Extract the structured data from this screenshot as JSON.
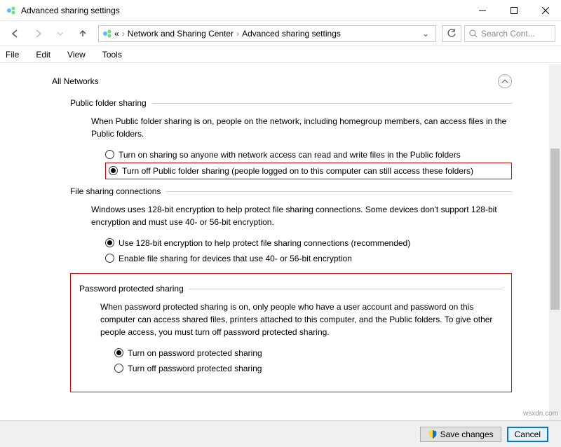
{
  "window": {
    "title": "Advanced sharing settings"
  },
  "nav": {
    "root": "«",
    "loc1": "Network and Sharing Center",
    "loc2": "Advanced sharing settings"
  },
  "search": {
    "placeholder": "Search Cont..."
  },
  "menu": {
    "file": "File",
    "edit": "Edit",
    "view": "View",
    "tools": "Tools"
  },
  "profile": {
    "name": "All Networks"
  },
  "pfs": {
    "legend": "Public folder sharing",
    "desc": "When Public folder sharing is on, people on the network, including homegroup members, can access files in the Public folders.",
    "opt1": "Turn on sharing so anyone with network access can read and write files in the Public folders",
    "opt2": "Turn off Public folder sharing (people logged on to this computer can still access these folders)"
  },
  "fsc": {
    "legend": "File sharing connections",
    "desc": "Windows uses 128-bit encryption to help protect file sharing connections. Some devices don't support 128-bit encryption and must use 40- or 56-bit encryption.",
    "opt1": "Use 128-bit encryption to help protect file sharing connections (recommended)",
    "opt2": "Enable file sharing for devices that use 40- or 56-bit encryption"
  },
  "pps": {
    "legend": "Password protected sharing",
    "desc": "When password protected sharing is on, only people who have a user account and password on this computer can access shared files, printers attached to this computer, and the Public folders. To give other people access, you must turn off password protected sharing.",
    "opt1": "Turn on password protected sharing",
    "opt2": "Turn off password protected sharing"
  },
  "footer": {
    "save": "Save changes",
    "cancel": "Cancel"
  },
  "watermark": "wsxdn.com"
}
